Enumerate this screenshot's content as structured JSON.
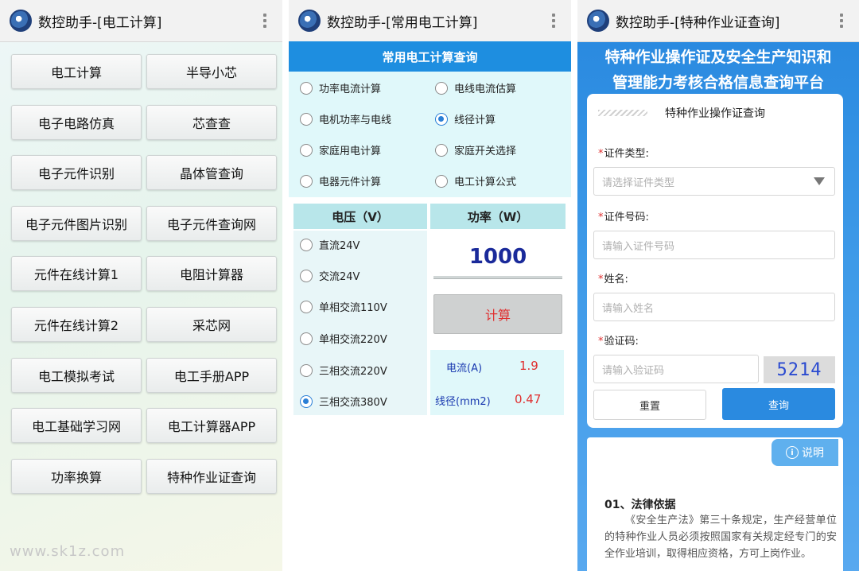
{
  "panel1": {
    "title": "数控助手-[电工计算]",
    "buttons": [
      "电工计算",
      "半导小芯",
      "电子电路仿真",
      "芯查查",
      "电子元件识别",
      "晶体管查询",
      "电子元件图片识别",
      "电子元件查询网",
      "元件在线计算1",
      "电阻计算器",
      "元件在线计算2",
      "采芯网",
      "电工模拟考试",
      "电工手册APP",
      "电工基础学习网",
      "电工计算器APP",
      "功率换算",
      "特种作业证查询"
    ],
    "watermark": "www.sk1z.com"
  },
  "panel2": {
    "title": "数控助手-[常用电工计算]",
    "header": "常用电工计算查询",
    "options": [
      {
        "label": "功率电流计算",
        "selected": false
      },
      {
        "label": "电线电流估算",
        "selected": false
      },
      {
        "label": "电机功率与电线",
        "selected": false
      },
      {
        "label": "线径计算",
        "selected": true
      },
      {
        "label": "家庭用电计算",
        "selected": false
      },
      {
        "label": "家庭开关选择",
        "selected": false
      },
      {
        "label": "电器元件计算",
        "selected": false
      },
      {
        "label": "电工计算公式",
        "selected": false
      }
    ],
    "voltage_header": "电压（V）",
    "power_header": "功率（W）",
    "voltages": [
      {
        "label": "直流24V",
        "selected": false
      },
      {
        "label": "交流24V",
        "selected": false
      },
      {
        "label": "单相交流110V",
        "selected": false
      },
      {
        "label": "单相交流220V",
        "selected": false
      },
      {
        "label": "三相交流220V",
        "selected": false
      },
      {
        "label": "三相交流380V",
        "selected": true
      }
    ],
    "power_value": "1000",
    "calc_button": "计算",
    "current_label": "电流(A)",
    "current_value": "1.9",
    "diameter_label": "线径(mm2)",
    "diameter_value": "0.47"
  },
  "panel3": {
    "title": "数控助手-[特种作业证查询]",
    "banner_line1": "特种作业操作证及安全生产知识和",
    "banner_line2": "管理能力考核合格信息查询平台",
    "card_title": "特种作业操作证查询",
    "cert_type_label": "证件类型:",
    "cert_type_placeholder": "请选择证件类型",
    "cert_no_label": "证件号码:",
    "cert_no_placeholder": "请输入证件号码",
    "name_label": "姓名:",
    "name_placeholder": "请输入姓名",
    "captcha_label": "验证码:",
    "captcha_placeholder": "请输入验证码",
    "captcha_code": "5214",
    "reset_button": "重置",
    "query_button": "查询",
    "info_button": "说明",
    "law_heading": "01、法律依据",
    "law_text": "《安全生产法》第三十条规定，生产经营单位的特种作业人员必须按照国家有关规定经专门的安全作业培训，取得相应资格，方可上岗作业。"
  },
  "colors": {
    "accent_blue": "#1e8ee0",
    "result_red": "#e03030",
    "power_blue": "#1a2a9a"
  }
}
